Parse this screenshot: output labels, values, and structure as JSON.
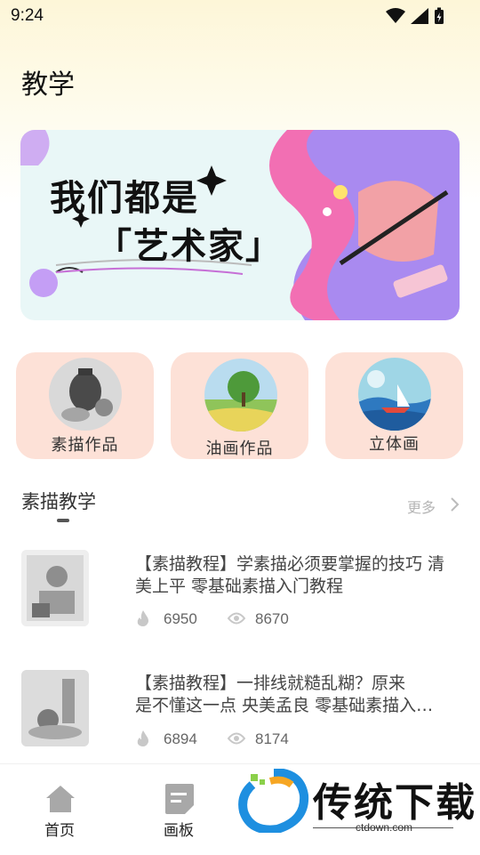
{
  "status": {
    "time": "9:24"
  },
  "header": {
    "title": "教学"
  },
  "banner": {
    "line1": "我们都是",
    "line2": "「艺术家」"
  },
  "categories": [
    {
      "label": "素描作品"
    },
    {
      "label": "油画作品"
    },
    {
      "label": "立体画"
    }
  ],
  "section": {
    "title": "素描教学",
    "more": "更多"
  },
  "articles": [
    {
      "title": "【素描教程】学素描必须要掌握的技巧 清美上平 零基础素描入门教程",
      "likes": "6950",
      "views": "8670"
    },
    {
      "title_line1": "【素描教程】一排线就糙乱糊？原来",
      "title_line2": "是不懂这一点  央美孟良 零基础素描入门教程",
      "likes": "6894",
      "views": "8174"
    }
  ],
  "nav": {
    "home": "首页",
    "board": "画板"
  },
  "watermark": {
    "text": "传统下载",
    "sub": "ctdown.com"
  },
  "colors": {
    "category_bg": "#fde1d7",
    "banner_bg": "#e9f7f7",
    "accent_purple": "#9b6cf0"
  }
}
